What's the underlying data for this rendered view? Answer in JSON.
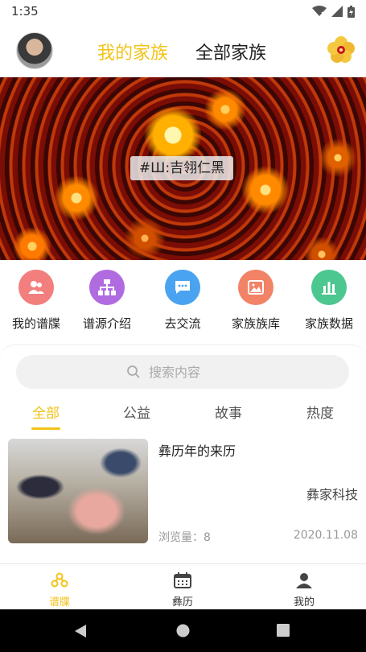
{
  "status_bar": {
    "time": "1:35"
  },
  "header": {
    "tab_mine": "我的家族",
    "tab_all": "全部家族"
  },
  "banner": {
    "caption": "#Ш:吉翎仁黑"
  },
  "quick_icons": [
    {
      "label": "我的谱牒",
      "color": "#f27e7e",
      "icon": "people-icon"
    },
    {
      "label": "谱源介绍",
      "color": "#b06be0",
      "icon": "hierarchy-icon"
    },
    {
      "label": "去交流",
      "color": "#4aa3f0",
      "icon": "chat-icon"
    },
    {
      "label": "家族族库",
      "color": "#f28367",
      "icon": "image-icon"
    },
    {
      "label": "家族数据",
      "color": "#4cc790",
      "icon": "bar-chart-icon"
    }
  ],
  "search": {
    "placeholder": "搜索内容"
  },
  "categories": [
    "全部",
    "公益",
    "故事",
    "热度"
  ],
  "active_category": "全部",
  "news": [
    {
      "title": "彝历年的来历",
      "source": "彝家科技",
      "views": "浏览量：8",
      "date": "2020.11.08"
    }
  ],
  "bottom_nav": [
    {
      "label": "谱牒",
      "icon": "family-icon",
      "active": true
    },
    {
      "label": "彝历",
      "icon": "calendar-icon",
      "active": false
    },
    {
      "label": "我的",
      "icon": "person-icon",
      "active": false
    }
  ],
  "colors": {
    "accent": "#f2c319"
  }
}
